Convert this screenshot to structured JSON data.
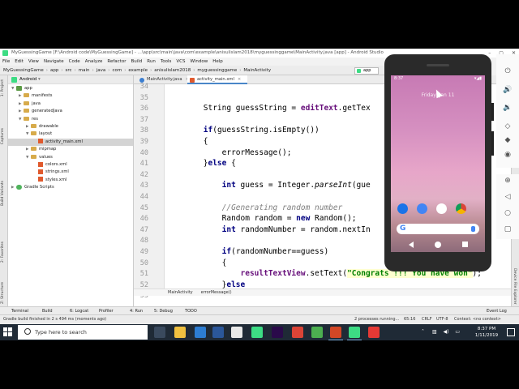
{
  "ide": {
    "title": "MyGuessingGame [F:\\Android code\\MyGuessingGame] - ...\\app\\src\\main\\java\\com\\example\\anisulislam2018\\myguessinggame\\MainActivity.java [app] - Android Studio",
    "menu": [
      "File",
      "Edit",
      "View",
      "Navigate",
      "Code",
      "Analyze",
      "Refactor",
      "Build",
      "Run",
      "Tools",
      "VCS",
      "Window",
      "Help"
    ],
    "breadcrumbs": [
      "MyGuessingGame",
      "app",
      "src",
      "main",
      "java",
      "com",
      "example",
      "anisulislam2018",
      "myguessinggame",
      "MainActivity"
    ],
    "run_config": "app",
    "left_tabs": [
      "1: Project",
      "Captures",
      "Build Variants",
      "2: Favorites",
      "Z: Structure"
    ],
    "project_view": "Android",
    "tree": [
      {
        "label": "app",
        "indent": 0,
        "arrow": "▼",
        "icon": "mod"
      },
      {
        "label": "manifests",
        "indent": 1,
        "arrow": "▶",
        "icon": "fold"
      },
      {
        "label": "java",
        "indent": 1,
        "arrow": "▶",
        "icon": "fold"
      },
      {
        "label": "generatedJava",
        "indent": 1,
        "arrow": "▶",
        "icon": "fold"
      },
      {
        "label": "res",
        "indent": 1,
        "arrow": "▼",
        "icon": "fold"
      },
      {
        "label": "drawable",
        "indent": 2,
        "arrow": "▶",
        "icon": "fold"
      },
      {
        "label": "layout",
        "indent": 2,
        "arrow": "▼",
        "icon": "fold"
      },
      {
        "label": "activity_main.xml",
        "indent": 3,
        "arrow": "",
        "icon": "xml",
        "selected": true
      },
      {
        "label": "mipmap",
        "indent": 2,
        "arrow": "▶",
        "icon": "fold"
      },
      {
        "label": "values",
        "indent": 2,
        "arrow": "▼",
        "icon": "fold"
      },
      {
        "label": "colors.xml",
        "indent": 3,
        "arrow": "",
        "icon": "xml"
      },
      {
        "label": "strings.xml",
        "indent": 3,
        "arrow": "",
        "icon": "xml"
      },
      {
        "label": "styles.xml",
        "indent": 3,
        "arrow": "",
        "icon": "xml"
      },
      {
        "label": "Gradle Scripts",
        "indent": 0,
        "arrow": "▶",
        "icon": "gradle"
      }
    ],
    "tabs": [
      {
        "label": "MainActivity.java",
        "kind": "java",
        "active": false
      },
      {
        "label": "activity_main.xml",
        "kind": "xml",
        "active": true
      }
    ],
    "line_numbers": [
      "34",
      "35",
      "36",
      "37",
      "38",
      "39",
      "40",
      "41",
      "42",
      "43",
      "44",
      "45",
      "46",
      "47",
      "48",
      "49",
      "50",
      "51",
      "52",
      "53"
    ],
    "code_crumbs": [
      "MainActivity",
      "errorMessage()"
    ],
    "toolwindows": [
      "Terminal",
      "Build",
      "6: Logcat",
      "Profiler",
      "4: Run",
      "5: Debug",
      "TODO",
      "Event Log"
    ],
    "status": {
      "message": "Gradle build finished in 2 s 494 ms (moments ago)",
      "processes": "2 processes running...",
      "position": "65:16",
      "line_sep": "CRLF",
      "encoding": "UTF-8",
      "context": "Context: <no context>"
    }
  },
  "code": [
    {
      "parts": []
    },
    {
      "parts": []
    },
    {
      "parts": [
        {
          "t": "        String guessString = "
        },
        {
          "t": "editText",
          "c": "fld"
        },
        {
          "t": ".getTex"
        }
      ]
    },
    {
      "parts": []
    },
    {
      "parts": [
        {
          "t": "        "
        },
        {
          "t": "if",
          "c": "kw"
        },
        {
          "t": "(guessString.isEmpty())"
        }
      ]
    },
    {
      "parts": [
        {
          "t": "        {"
        }
      ]
    },
    {
      "parts": [
        {
          "t": "            errorMessage();"
        }
      ]
    },
    {
      "parts": [
        {
          "t": "        }"
        },
        {
          "t": "else",
          "c": "kw"
        },
        {
          "t": " {"
        }
      ]
    },
    {
      "parts": []
    },
    {
      "parts": [
        {
          "t": "            "
        },
        {
          "t": "int",
          "c": "kw"
        },
        {
          "t": " guess = Integer."
        },
        {
          "t": "parseInt",
          "c": "itl"
        },
        {
          "t": "(gue"
        }
      ]
    },
    {
      "parts": []
    },
    {
      "parts": [
        {
          "t": "            "
        },
        {
          "t": "//Generating random number",
          "c": "cm"
        }
      ]
    },
    {
      "parts": [
        {
          "t": "            Random random = "
        },
        {
          "t": "new",
          "c": "kw"
        },
        {
          "t": " Random();"
        }
      ]
    },
    {
      "parts": [
        {
          "t": "            "
        },
        {
          "t": "int",
          "c": "kw"
        },
        {
          "t": " randomNumber = random.nextIn"
        }
      ]
    },
    {
      "parts": []
    },
    {
      "parts": [
        {
          "t": "            "
        },
        {
          "t": "if",
          "c": "kw"
        },
        {
          "t": "(randomNumber==guess)"
        }
      ]
    },
    {
      "parts": [
        {
          "t": "            {"
        }
      ]
    },
    {
      "parts": [
        {
          "t": "                "
        },
        {
          "t": "resultTextView",
          "c": "fld"
        },
        {
          "t": ".setText("
        },
        {
          "t": "\"Congrats !!! You have won\"",
          "c": "str"
        },
        {
          "t": ");"
        }
      ]
    },
    {
      "parts": [
        {
          "t": "            }"
        },
        {
          "t": "else",
          "c": "kw"
        }
      ]
    },
    {
      "parts": []
    }
  ],
  "phone": {
    "time": "8:37",
    "date": "Friday, Jan 11",
    "dock_colors": [
      "#1a73e8",
      "#4285f4",
      "#ffffff",
      "#34a853"
    ],
    "search_glyph": "G"
  },
  "taskbar": {
    "search_placeholder": "Type here to search",
    "time": "8:37 PM",
    "date": "1/11/2019",
    "apps": [
      {
        "name": "task-view",
        "color": "#3a4a5e"
      },
      {
        "name": "file-explorer",
        "color": "#f0c040"
      },
      {
        "name": "store",
        "color": "#2d7dd2"
      },
      {
        "name": "word",
        "color": "#2b579a"
      },
      {
        "name": "notepad",
        "color": "#e8e8e8"
      },
      {
        "name": "camtasia",
        "color": "#3ddc84"
      },
      {
        "name": "premiere",
        "color": "#2a0a4a"
      },
      {
        "name": "chrome",
        "color": "#db4437"
      },
      {
        "name": "other-app",
        "color": "#4caf50"
      },
      {
        "name": "powerpoint",
        "color": "#d24726"
      },
      {
        "name": "android-studio",
        "color": "#3ddc84"
      },
      {
        "name": "recorder",
        "color": "#e53935"
      }
    ]
  }
}
